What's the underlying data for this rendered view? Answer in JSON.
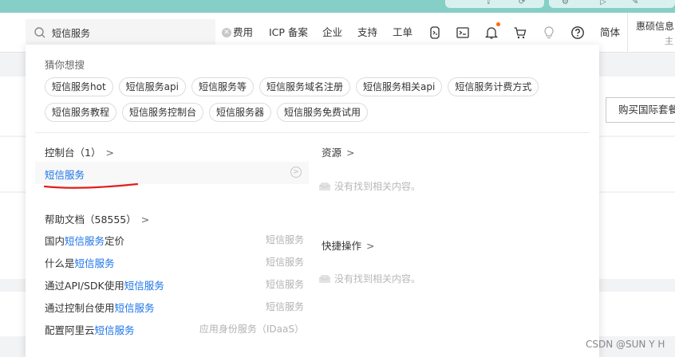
{
  "header": {
    "search": {
      "value": "短信服务",
      "placeholder": ""
    },
    "nav": [
      "费用",
      "ICP 备案",
      "企业",
      "支持",
      "工单",
      "简体"
    ],
    "account": {
      "name": "惠硕信息",
      "sub": "主"
    }
  },
  "page": {
    "buy_button": "购买国际套餐"
  },
  "dropdown": {
    "guess": {
      "title": "猜你想搜",
      "tags_row1": [
        "短信服务hot",
        "短信服务api",
        "短信服务等",
        "短信服务域名注册",
        "短信服务相关api",
        "短信服务计费方式"
      ],
      "tags_row2": [
        "短信服务教程",
        "短信服务控制台",
        "短信服务器",
        "短信服务免费试用"
      ]
    },
    "console": {
      "title": "控制台（1）",
      "chevron": ">",
      "item": "短信服务",
      "go_icon": ">"
    },
    "docs": {
      "title": "帮助文档（58555）",
      "chevron": ">",
      "items": [
        {
          "pre": "国内",
          "hl": "短信服务",
          "post": "定价",
          "tag": "短信服务"
        },
        {
          "pre": "什么是",
          "hl": "短信服务",
          "post": "",
          "tag": "短信服务"
        },
        {
          "pre": "通过API/SDK使用",
          "hl": "短信服务",
          "post": "",
          "tag": "短信服务"
        },
        {
          "pre": "通过控制台使用",
          "hl": "短信服务",
          "post": "",
          "tag": "短信服务"
        },
        {
          "pre": "配置阿里云",
          "hl": "短信服务",
          "post": "",
          "tag": "应用身份服务（IDaaS）"
        }
      ]
    },
    "resources": {
      "title": "资源",
      "chevron": ">",
      "empty": "没有找到相关内容。"
    },
    "quick": {
      "title": "快捷操作",
      "chevron": ">",
      "empty": "没有找到相关内容。"
    }
  },
  "watermark": "CSDN @SUN Y H",
  "colors": {
    "link": "#1a73e8",
    "accent": "#ff6a00",
    "strip": "#86cfc7",
    "annotation": "#e0201b"
  },
  "icons": [
    "search-icon",
    "clear-icon",
    "cli-icon",
    "terminal-icon",
    "bell-icon",
    "cart-icon",
    "bulb-icon",
    "help-icon",
    "chevron-right-icon",
    "empty-box-icon"
  ]
}
